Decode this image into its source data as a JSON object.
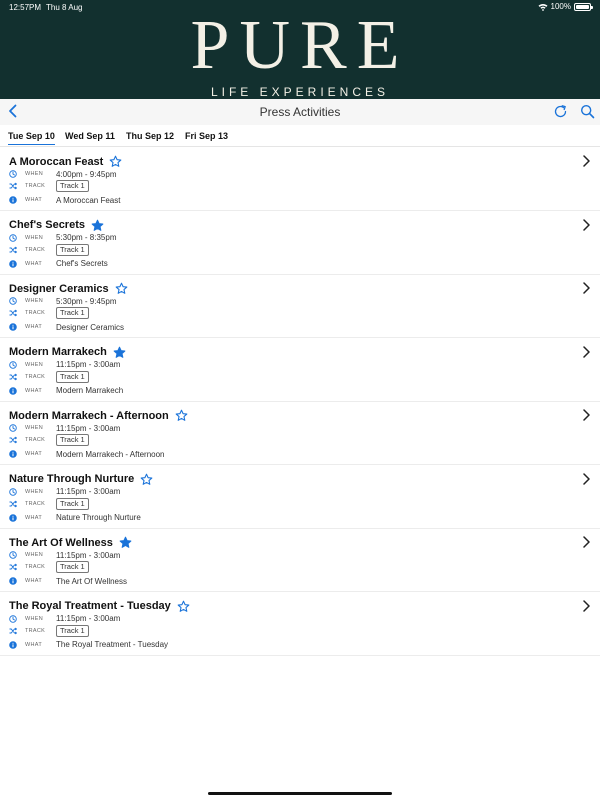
{
  "status_bar": {
    "time": "12:57PM",
    "date": "Thu 8 Aug",
    "battery": "100%"
  },
  "brand": {
    "name": "PURE",
    "tagline": "LIFE EXPERIENCES"
  },
  "nav": {
    "title": "Press Activities"
  },
  "tabs": [
    {
      "label": "Tue Sep 10",
      "active": true
    },
    {
      "label": "Wed Sep 11",
      "active": false
    },
    {
      "label": "Thu Sep 12",
      "active": false
    },
    {
      "label": "Fri Sep 13",
      "active": false
    }
  ],
  "labels": {
    "when": "WHEN",
    "track": "TRACK",
    "what": "WHAT"
  },
  "items": [
    {
      "title": "A Moroccan Feast",
      "favorited": false,
      "when": "4:00pm - 9:45pm",
      "track": "Track 1",
      "what": "A Moroccan Feast"
    },
    {
      "title": "Chef's Secrets",
      "favorited": true,
      "when": "5:30pm - 8:35pm",
      "track": "Track 1",
      "what": "Chef's Secrets"
    },
    {
      "title": "Designer Ceramics",
      "favorited": false,
      "when": "5:30pm - 9:45pm",
      "track": "Track 1",
      "what": "Designer Ceramics"
    },
    {
      "title": "Modern Marrakech",
      "favorited": true,
      "when": "11:15pm - 3:00am",
      "track": "Track 1",
      "what": "Modern Marrakech"
    },
    {
      "title": "Modern Marrakech - Afternoon",
      "favorited": false,
      "when": "11:15pm - 3:00am",
      "track": "Track 1",
      "what": "Modern Marrakech - Afternoon"
    },
    {
      "title": "Nature Through Nurture",
      "favorited": false,
      "when": "11:15pm - 3:00am",
      "track": "Track 1",
      "what": "Nature Through Nurture"
    },
    {
      "title": "The Art Of Wellness",
      "favorited": true,
      "when": "11:15pm - 3:00am",
      "track": "Track 1",
      "what": "The Art Of Wellness"
    },
    {
      "title": "The Royal Treatment - Tuesday",
      "favorited": false,
      "when": "11:15pm - 3:00am",
      "track": "Track 1",
      "what": "The Royal Treatment - Tuesday"
    }
  ],
  "colors": {
    "header_bg": "#12302f",
    "accent": "#1a73d9",
    "brand_text": "#f3f0e6"
  }
}
